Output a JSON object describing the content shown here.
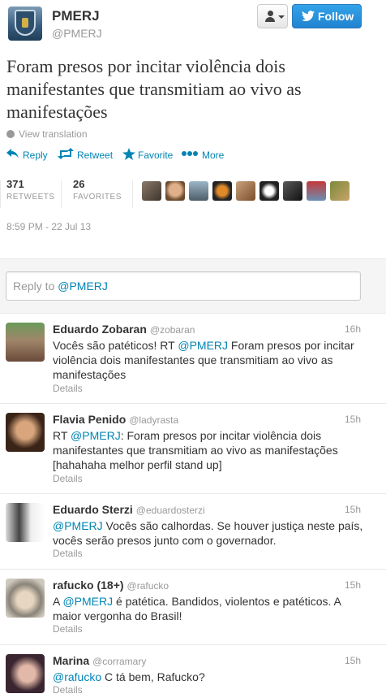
{
  "header": {
    "name": "PMERJ",
    "handle": "@PMERJ",
    "follow_label": "Follow"
  },
  "tweet": {
    "text": "Foram presos por incitar violência dois manifestantes que transmitiam ao vivo as manifestações",
    "view_translation": "View translation",
    "actions": {
      "reply": "Reply",
      "retweet": "Retweet",
      "favorite": "Favorite",
      "more": "More"
    },
    "stats": {
      "retweets_count": "371",
      "retweets_label": "RETWEETS",
      "favorites_count": "26",
      "favorites_label": "FAVORITES"
    },
    "timestamp": "8:59 PM - 22 Jul 13"
  },
  "reply_box": {
    "prefix": "Reply to ",
    "mention": "@PMERJ"
  },
  "replies": [
    {
      "name": "Eduardo Zobaran",
      "handle": "@zobaran",
      "time": "16h",
      "text_pre": "Vocês são patéticos! RT ",
      "mention": "@PMERJ",
      "text_post": " Foram presos por incitar violência dois manifestantes que transmitiam ao vivo as manifestações",
      "details": "Details"
    },
    {
      "name": "Flavia Penido",
      "handle": "@ladyrasta",
      "time": "15h",
      "text_pre": "RT ",
      "mention": "@PMERJ",
      "text_post": ": Foram presos por incitar violência dois manifestantes que transmitiam ao vivo as manifestações [hahahaha melhor perfil stand up]",
      "details": "Details"
    },
    {
      "name": "Eduardo Sterzi",
      "handle": "@eduardosterzi",
      "time": "15h",
      "text_pre": "",
      "mention": "@PMERJ",
      "text_post": " Vocês são calhordas. Se houver justiça neste país, vocês serão presos junto com o governador.",
      "details": "Details"
    },
    {
      "name": "rafucko (18+)",
      "handle": "@rafucko",
      "time": "15h",
      "text_pre": "A ",
      "mention": "@PMERJ",
      "text_post": " é patética. Bandidos, violentos e patéticos. A maior vergonha do Brasil!",
      "details": "Details"
    },
    {
      "name": "Marina",
      "handle": "@corramary",
      "time": "15h",
      "text_pre": "",
      "mention": "@rafucko",
      "text_post": " C tá bem, Rafucko?",
      "details": "Details"
    }
  ],
  "colors": {
    "link": "#0084b4",
    "follow_button": "#2183d0",
    "muted": "#999999"
  },
  "icons": [
    "user-icon",
    "twitter-bird-icon",
    "globe-icon",
    "reply-icon",
    "retweet-icon",
    "favorite-star-icon",
    "more-dots-icon"
  ]
}
